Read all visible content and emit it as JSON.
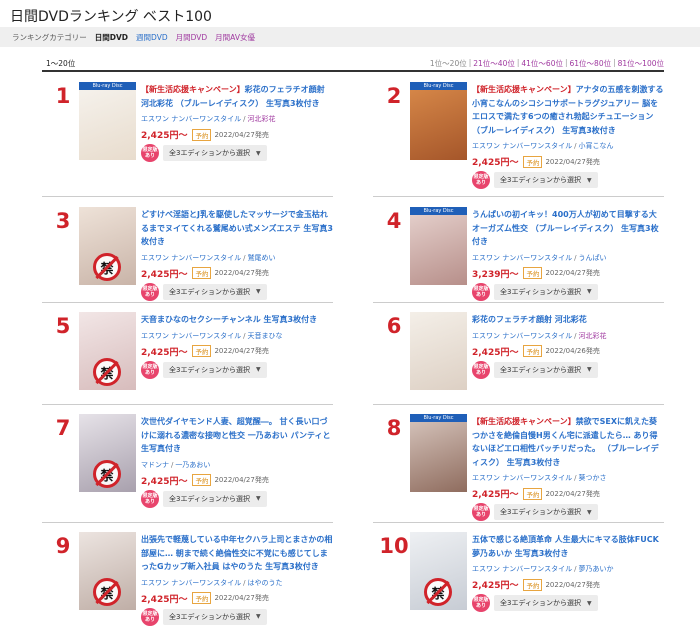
{
  "page": {
    "title": "日間DVDランキング ベスト100"
  },
  "categories": {
    "label": "ランキングカテゴリー",
    "items": [
      {
        "text": "日間DVD",
        "style": "current"
      },
      {
        "text": "週間DVD",
        "style": "blue"
      },
      {
        "text": "月間DVD",
        "style": "purple"
      },
      {
        "text": "月間AV女優",
        "style": "purple"
      }
    ]
  },
  "range": {
    "current": "1〜20位",
    "pages": [
      {
        "text": "1位〜20位",
        "link": false
      },
      {
        "text": "21位〜40位",
        "link": true
      },
      {
        "text": "41位〜60位",
        "link": true
      },
      {
        "text": "61位〜80位",
        "link": true
      },
      {
        "text": "81位〜100位",
        "link": true
      }
    ]
  },
  "common": {
    "badge": "限定版あり",
    "edition_select": "全3エディションから選択",
    "yoyaku": "予約",
    "bluray_label": "Blu-ray Disc"
  },
  "items": [
    {
      "rank": "1",
      "campaign": "【新生活応援キャンペーン】",
      "title": "彩花のフェラチオ顔射 河北彩花 （ブルーレイディスク） 生写真3枚付き",
      "maker": "エスワン ナンバーワンスタイル",
      "actress": "河北彩花",
      "actress_purple": true,
      "price": "2,425円〜",
      "release": "2022/04/27発売",
      "bluray": true,
      "banned": false,
      "cover": [
        "#f6f3ee",
        "#e8dccd"
      ]
    },
    {
      "rank": "2",
      "campaign": "【新生活応援キャンペーン】",
      "title": "アナタの五感を刺激する小宵こなんのシコシコサポートラグジュアリー 脳をエロスで満たす6つの癒され勃起シチュエーション （ブルーレイディスク） 生写真3枚付き",
      "maker": "エスワン ナンバーワンスタイル",
      "actress": "小宵こなん",
      "actress_purple": false,
      "price": "2,425円〜",
      "release": "2022/04/27発売",
      "bluray": true,
      "banned": false,
      "cover": [
        "#d98a4a",
        "#a5562a"
      ]
    },
    {
      "rank": "3",
      "campaign": "",
      "title": "どすけべ淫語とJ乳を駆使したマッサージで金玉枯れるまでヌイてくれる鷲尾めい式メンズエステ 生写真3枚付き",
      "maker": "エスワン ナンバーワンスタイル",
      "actress": "鷲尾めい",
      "actress_purple": false,
      "price": "2,425円〜",
      "release": "2022/04/27発売",
      "bluray": false,
      "banned": true,
      "cover": [
        "#eee2d8",
        "#c9b4a8"
      ]
    },
    {
      "rank": "4",
      "campaign": "",
      "title": "うんぱいの初イキッ！400万人が初めて目撃する大オーガズム性交 （ブルーレイディスク） 生写真3枚付き",
      "maker": "エスワン ナンバーワンスタイル",
      "actress": "うんぱい",
      "actress_purple": false,
      "price": "3,239円〜",
      "release": "2022/04/27発売",
      "bluray": true,
      "banned": false,
      "cover": [
        "#e7d3cf",
        "#b78f8a"
      ]
    },
    {
      "rank": "5",
      "campaign": "",
      "title": "天音まひなのセクシーチャンネル 生写真3枚付き",
      "maker": "エスワン ナンバーワンスタイル",
      "actress": "天音まひな",
      "actress_purple": false,
      "price": "2,425円〜",
      "release": "2022/04/27発売",
      "bluray": false,
      "banned": true,
      "cover": [
        "#f2e6e6",
        "#d7bcbc"
      ]
    },
    {
      "rank": "6",
      "campaign": "",
      "title": "彩花のフェラチオ顔射 河北彩花",
      "maker": "エスワン ナンバーワンスタイル",
      "actress": "河北彩花",
      "actress_purple": true,
      "price": "2,425円〜",
      "release": "2022/04/26発売",
      "bluray": false,
      "banned": false,
      "cover": [
        "#f4efe8",
        "#ddd0c4"
      ]
    },
    {
      "rank": "7",
      "campaign": "",
      "title": "次世代ダイヤモンド人妻、超覚醒―。 甘く長い口づけに溺れる濃密な接吻と性交 一乃あおい パンティと生写真付き",
      "maker": "マドンナ",
      "actress": "一乃あおい",
      "actress_purple": false,
      "price": "2,425円〜",
      "release": "2022/04/27発売",
      "bluray": false,
      "banned": true,
      "cover": [
        "#e6e2e8",
        "#a8a0ad"
      ]
    },
    {
      "rank": "8",
      "campaign": "【新生活応援キャンペーン】",
      "title": "禁欲でSEXに飢えた葵つかさを絶倫自慢H男くん宅に派遣したら… あり得ないほどエロ相性バッチリだった。 （ブルーレイディスク） 生写真3枚付き",
      "maker": "エスワン ナンバーワンスタイル",
      "actress": "葵つかさ",
      "actress_purple": false,
      "price": "2,425円〜",
      "release": "2022/04/27発売",
      "bluray": true,
      "banned": false,
      "cover": [
        "#d8c7bf",
        "#8f6c5e"
      ]
    },
    {
      "rank": "9",
      "campaign": "",
      "title": "出張先で軽蔑している中年セクハラ上司とまさかの相部屋に… 朝まで続く絶倫性交に不覚にも感じてしまったGカップ新入社員 はやのうた 生写真3枚付き",
      "maker": "エスワン ナンバーワンスタイル",
      "actress": "はやのうた",
      "actress_purple": false,
      "price": "2,425円〜",
      "release": "2022/04/27発売",
      "bluray": false,
      "banned": true,
      "cover": [
        "#ece4e0",
        "#bfaea6"
      ]
    },
    {
      "rank": "10",
      "campaign": "",
      "title": "五体で感じる絶頂革命 人生最大にキマる肢体FUCK 夢乃あいか 生写真3枚付き",
      "maker": "エスワン ナンバーワンスタイル",
      "actress": "夢乃あいか",
      "actress_purple": false,
      "price": "2,425円〜",
      "release": "2022/04/27発売",
      "bluray": false,
      "banned": true,
      "cover": [
        "#eef0f3",
        "#c7ccd4"
      ]
    }
  ]
}
